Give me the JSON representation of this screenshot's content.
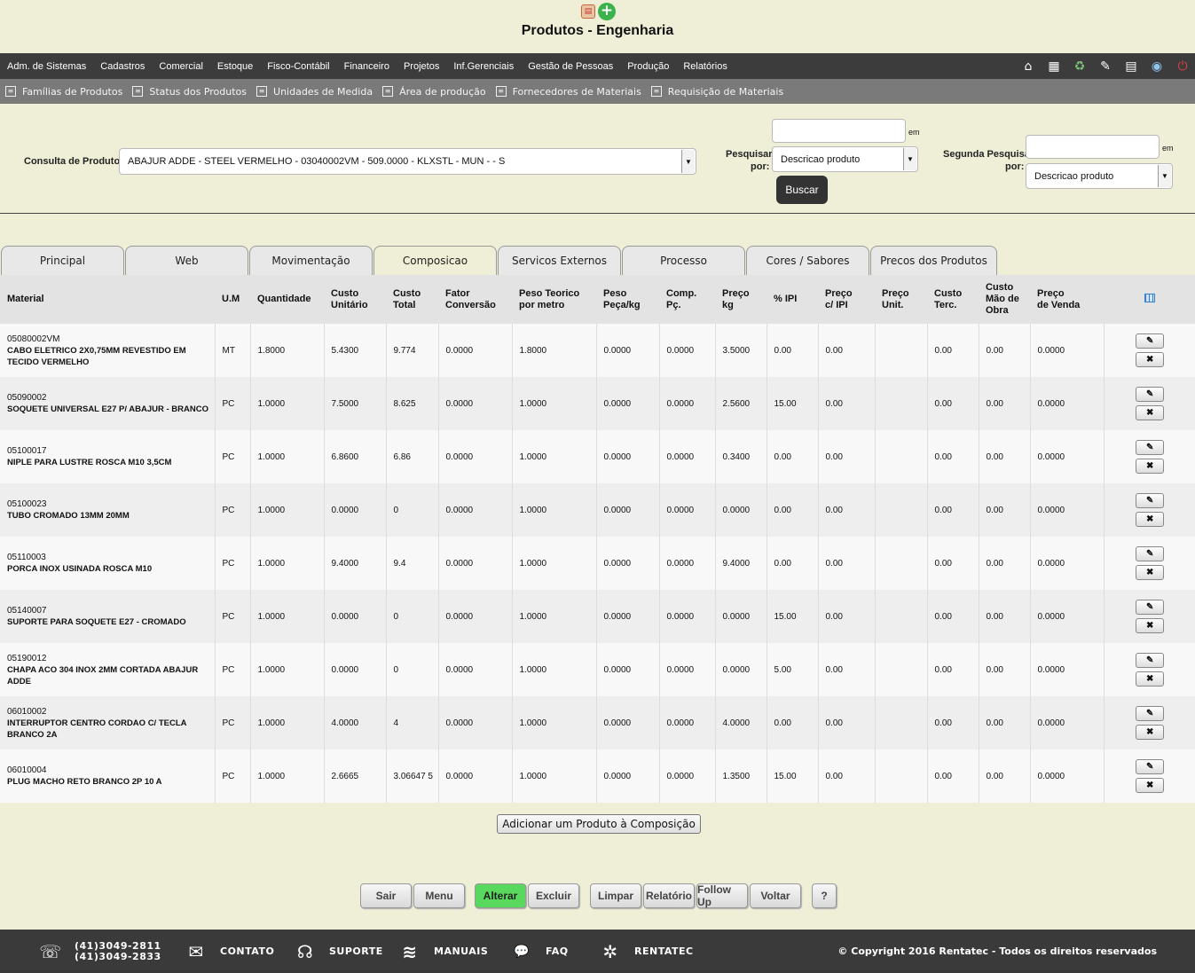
{
  "header": {
    "title": "Produtos - Engenharia",
    "top_icons": [
      "report-icon",
      "add-icon"
    ]
  },
  "menu": [
    "Adm. de Sistemas",
    "Cadastros",
    "Comercial",
    "Estoque",
    "Fisco-Contábil",
    "Financeiro",
    "Projetos",
    "Inf.Gerenciais",
    "Gestão de Pessoas",
    "Produção",
    "Relatórios"
  ],
  "menu_right_icons": [
    "home-icon",
    "printer-icon",
    "recycle-icon",
    "edit-doc-icon",
    "document-icon",
    "globe-icon",
    "power-icon"
  ],
  "submenu": [
    "Famílias de Produtos",
    "Status dos Produtos",
    "Unidades de Medida",
    "Área de produção",
    "Fornecedores de Materiais",
    "Requisição de Materiais"
  ],
  "search": {
    "consulta_label": "Consulta de Produtos",
    "consulta_value": "ABAJUR ADDE - STEEL VERMELHO - 03040002VM - 509.0000 - KLXSTL - MUN - - S",
    "pesquisar_label1": "Pesquisar",
    "pesquisar_label2": "por:",
    "em_label": "em",
    "search_value": "",
    "pesquisar_select": "Descricao produto",
    "buscar_label": "Buscar",
    "segunda_label1": "Segunda Pesquisa",
    "segunda_label2": "por:",
    "segunda_value": "",
    "segunda_select": "Descricao produto"
  },
  "tabs": [
    "Principal",
    "Web",
    "Movimentação",
    "Composicao",
    "Servicos Externos",
    "Processo",
    "Cores / Sabores",
    "Precos dos Produtos"
  ],
  "active_tab": "Composicao",
  "table": {
    "headers": [
      [
        "Material"
      ],
      [
        "U.M"
      ],
      [
        "Quantidade"
      ],
      [
        "Custo",
        "Unitário"
      ],
      [
        "Custo",
        "Total"
      ],
      [
        "Fator",
        "Conversão"
      ],
      [
        "Peso Teorico",
        "por metro"
      ],
      [
        "Peso",
        "Peça/kg"
      ],
      [
        "Comp.",
        "Pç."
      ],
      [
        "Preço",
        "kg"
      ],
      [
        "% IPI"
      ],
      [
        "Preço",
        "c/ IPI"
      ],
      [
        "Preço",
        "Unit."
      ],
      [
        "Custo",
        "Terc."
      ],
      [
        "Custo",
        "Mão de",
        "Obra"
      ],
      [
        "Preço",
        "de Venda"
      ]
    ],
    "rows": [
      {
        "code": "05080002VM",
        "desc": "CABO ELETRICO 2X0,75MM REVESTIDO EM TECIDO VERMELHO",
        "um": "MT",
        "qtd": "1.8000",
        "cu": "5.4300",
        "ct": "9.774",
        "fc": "0.0000",
        "ptm": "1.8000",
        "ppk": "0.0000",
        "comp": "0.0000",
        "pkg": "3.5000",
        "ipi": "0.00",
        "pci": "0.00",
        "pu": "",
        "cterc": "0.00",
        "cmo": "0.00",
        "pv": "0.0000"
      },
      {
        "code": "05090002",
        "desc": "SOQUETE UNIVERSAL E27 P/ ABAJUR - BRANCO",
        "um": "PC",
        "qtd": "1.0000",
        "cu": "7.5000",
        "ct": "8.625",
        "fc": "0.0000",
        "ptm": "1.0000",
        "ppk": "0.0000",
        "comp": "0.0000",
        "pkg": "2.5600",
        "ipi": "15.00",
        "pci": "0.00",
        "pu": "",
        "cterc": "0.00",
        "cmo": "0.00",
        "pv": "0.0000"
      },
      {
        "code": "05100017",
        "desc": "NIPLE PARA LUSTRE ROSCA M10 3,5CM",
        "um": "PC",
        "qtd": "1.0000",
        "cu": "6.8600",
        "ct": "6.86",
        "fc": "0.0000",
        "ptm": "1.0000",
        "ppk": "0.0000",
        "comp": "0.0000",
        "pkg": "0.3400",
        "ipi": "0.00",
        "pci": "0.00",
        "pu": "",
        "cterc": "0.00",
        "cmo": "0.00",
        "pv": "0.0000"
      },
      {
        "code": "05100023",
        "desc": "TUBO CROMADO 13MM 20MM",
        "um": "PC",
        "qtd": "1.0000",
        "cu": "0.0000",
        "ct": "0",
        "fc": "0.0000",
        "ptm": "1.0000",
        "ppk": "0.0000",
        "comp": "0.0000",
        "pkg": "0.0000",
        "ipi": "0.00",
        "pci": "0.00",
        "pu": "",
        "cterc": "0.00",
        "cmo": "0.00",
        "pv": "0.0000"
      },
      {
        "code": "05110003",
        "desc": "PORCA INOX USINADA ROSCA M10",
        "um": "PC",
        "qtd": "1.0000",
        "cu": "9.4000",
        "ct": "9.4",
        "fc": "0.0000",
        "ptm": "1.0000",
        "ppk": "0.0000",
        "comp": "0.0000",
        "pkg": "9.4000",
        "ipi": "0.00",
        "pci": "0.00",
        "pu": "",
        "cterc": "0.00",
        "cmo": "0.00",
        "pv": "0.0000"
      },
      {
        "code": "05140007",
        "desc": "SUPORTE PARA SOQUETE E27 - CROMADO",
        "um": "PC",
        "qtd": "1.0000",
        "cu": "0.0000",
        "ct": "0",
        "fc": "0.0000",
        "ptm": "1.0000",
        "ppk": "0.0000",
        "comp": "0.0000",
        "pkg": "0.0000",
        "ipi": "15.00",
        "pci": "0.00",
        "pu": "",
        "cterc": "0.00",
        "cmo": "0.00",
        "pv": "0.0000"
      },
      {
        "code": "05190012",
        "desc": "CHAPA ACO 304 INOX 2MM CORTADA ABAJUR ADDE",
        "um": "PC",
        "qtd": "1.0000",
        "cu": "0.0000",
        "ct": "0",
        "fc": "0.0000",
        "ptm": "1.0000",
        "ppk": "0.0000",
        "comp": "0.0000",
        "pkg": "0.0000",
        "ipi": "5.00",
        "pci": "0.00",
        "pu": "",
        "cterc": "0.00",
        "cmo": "0.00",
        "pv": "0.0000"
      },
      {
        "code": "06010002",
        "desc": "INTERRUPTOR CENTRO CORDAO C/ TECLA BRANCO 2A",
        "um": "PC",
        "qtd": "1.0000",
        "cu": "4.0000",
        "ct": "4",
        "fc": "0.0000",
        "ptm": "1.0000",
        "ppk": "0.0000",
        "comp": "0.0000",
        "pkg": "4.0000",
        "ipi": "0.00",
        "pci": "0.00",
        "pu": "",
        "cterc": "0.00",
        "cmo": "0.00",
        "pv": "0.0000"
      },
      {
        "code": "06010004",
        "desc": "PLUG MACHO RETO BRANCO 2P 10 A",
        "um": "PC",
        "qtd": "1.0000",
        "cu": "2.6665",
        "ct": "3.06647 5",
        "fc": "0.0000",
        "ptm": "1.0000",
        "ppk": "0.0000",
        "comp": "0.0000",
        "pkg": "1.3500",
        "ipi": "15.00",
        "pci": "0.00",
        "pu": "",
        "cterc": "0.00",
        "cmo": "0.00",
        "pv": "0.0000"
      }
    ]
  },
  "add_button": "Adicionar um Produto à Composição",
  "bottom_buttons": {
    "sair": "Sair",
    "menu": "Menu",
    "alterar": "Alterar",
    "excluir": "Excluir",
    "limpar": "Limpar",
    "relatorio": "Relatório",
    "followup": "Follow Up",
    "voltar": "Voltar",
    "help": "?"
  },
  "footer": {
    "phone1": "(41)3049-2811",
    "phone2": "(41)3049-2833",
    "contato": "CONTATO",
    "suporte": "SUPORTE",
    "manuais": "MANUAIS",
    "faq": "FAQ",
    "rentatec": "RENTATEC",
    "copyright": "© Copyright 2016 Rentatec - Todos os direitos reservados"
  }
}
